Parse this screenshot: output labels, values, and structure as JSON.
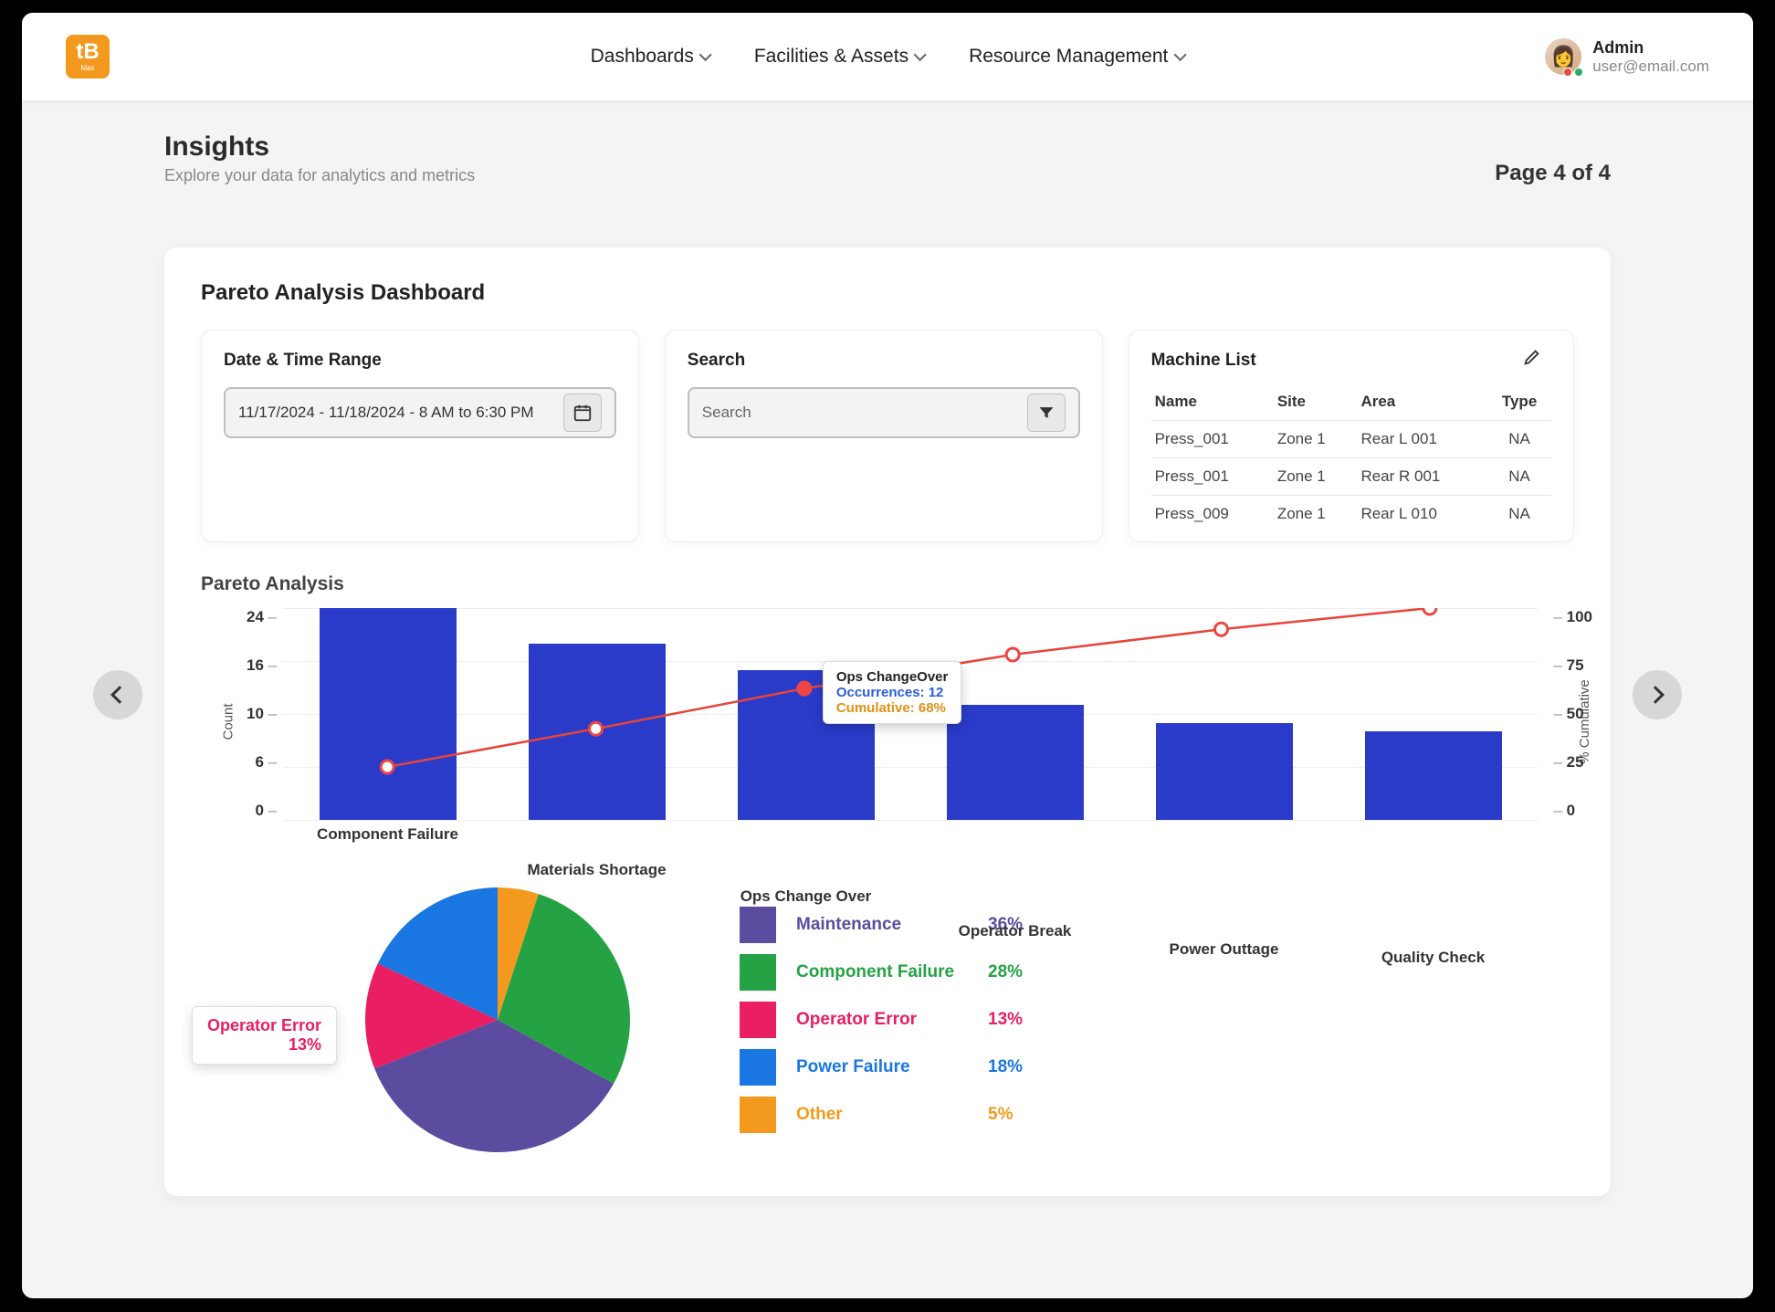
{
  "brand": "tB",
  "brand_sub": "Max",
  "nav": [
    "Dashboards",
    "Facilities & Assets",
    "Resource Management"
  ],
  "user": {
    "name": "Admin",
    "email": "user@email.com"
  },
  "page": {
    "title": "Insights",
    "subtitle": "Explore your data for analytics and metrics",
    "page_label": "Page 4 of 4"
  },
  "dashboard": {
    "title": "Pareto Analysis Dashboard"
  },
  "date_panel": {
    "title": "Date & Time Range",
    "value": "11/17/2024 -  11/18/2024 -   8 AM to 6:30 PM"
  },
  "search_panel": {
    "title": "Search",
    "placeholder": "Search"
  },
  "machine_panel": {
    "title": "Machine List",
    "headers": [
      "Name",
      "Site",
      "Area",
      "Type"
    ],
    "rows": [
      [
        "Press_001",
        "Zone 1",
        "Rear L 001",
        "NA"
      ],
      [
        "Press_001",
        "Zone 1",
        "Rear R 001",
        "NA"
      ],
      [
        "Press_009",
        "Zone 1",
        "Rear L 010",
        "NA"
      ]
    ]
  },
  "pareto_title": "Pareto Analysis",
  "tooltip": {
    "title": "Ops ChangeOver",
    "occ_label": "Occurrences:",
    "occ_val": "12",
    "cum_label": "Cumulative:",
    "cum_val": "68%"
  },
  "pie_callout": {
    "label": "Operator Error",
    "pct": "13%"
  },
  "legend": [
    {
      "label": "Maintenance",
      "pct": "36%",
      "color": "#5b4c9f",
      "cls": "c-purple"
    },
    {
      "label": "Component Failure",
      "pct": "28%",
      "color": "#25a244",
      "cls": "c-green"
    },
    {
      "label": "Operator Error",
      "pct": "13%",
      "color": "#e91e63",
      "cls": "c-pink"
    },
    {
      "label": "Power Failure",
      "pct": "18%",
      "color": "#1a77e2",
      "cls": "c-blue"
    },
    {
      "label": "Other",
      "pct": "5%",
      "color": "#f39a1e",
      "cls": "c-orange"
    }
  ],
  "chart_data": {
    "type": "pareto",
    "y_left_label": "Count",
    "y_left_ticks": [
      24,
      16,
      10,
      6,
      0
    ],
    "y_left_range": [
      0,
      24
    ],
    "y_right_label": "% Cumulative",
    "y_right_ticks": [
      100,
      75,
      50,
      25,
      0
    ],
    "y_right_range": [
      0,
      100
    ],
    "categories": [
      "Component Failure",
      "Materials Shortage",
      "Ops Change Over",
      "Operator Break",
      "Power Outtage",
      "Quality Check"
    ],
    "bars": [
      24,
      20,
      17,
      13,
      11,
      10
    ],
    "cumulative_pct": [
      25,
      43,
      62,
      78,
      90,
      100
    ],
    "tooltip_index": 2
  },
  "pie_data": {
    "type": "pie",
    "slices": [
      {
        "label": "Maintenance",
        "pct": 36,
        "color": "#5b4c9f"
      },
      {
        "label": "Component Failure",
        "pct": 28,
        "color": "#25a244"
      },
      {
        "label": "Operator Error",
        "pct": 13,
        "color": "#e91e63"
      },
      {
        "label": "Power Failure",
        "pct": 18,
        "color": "#1a77e2"
      },
      {
        "label": "Other",
        "pct": 5,
        "color": "#f39a1e"
      }
    ]
  }
}
